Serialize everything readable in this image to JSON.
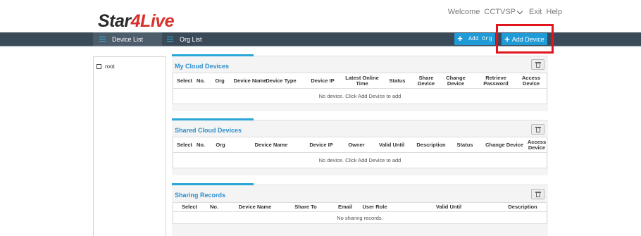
{
  "header": {
    "logo_main": "Star",
    "logo_accent": "4Live",
    "welcome": "Welcome",
    "username": "CCTVSP",
    "exit": "Exit",
    "help": "Help"
  },
  "nav": {
    "tabs": [
      {
        "label": "Device List",
        "active": true
      },
      {
        "label": "Org List",
        "active": false
      }
    ],
    "add_org": "Add Org",
    "add_device": "Add Device"
  },
  "tree": {
    "root": "root"
  },
  "panels": {
    "my_devices": {
      "title": "My Cloud Devices",
      "columns": [
        "Select",
        "No.",
        "Org",
        "Device Name",
        "Device Type",
        "Device IP",
        "Latest Online Time",
        "Status",
        "Share Device",
        "Change Device",
        "Retrieve Password",
        "Access Device"
      ],
      "empty": "No device. Click Add Device to add"
    },
    "shared_devices": {
      "title": "Shared Cloud Devices",
      "columns": [
        "Select",
        "No.",
        "Org",
        "Device Name",
        "Device IP",
        "Owner",
        "Valid Until",
        "Description",
        "Status",
        "Change Device",
        "Access Device"
      ],
      "empty": "No device. Click Add Device to add"
    },
    "sharing_records": {
      "title": "Sharing Records",
      "columns": [
        "Select",
        "No.",
        "Device Name",
        "Share To",
        "Email",
        "User Role",
        "Valid Until",
        "Description"
      ],
      "empty": "No sharing records."
    }
  },
  "colors": {
    "navbar": "#3b4a58",
    "accent": "#1f9bd7",
    "title": "#2d8fcf",
    "highlight": "#e0161c"
  }
}
